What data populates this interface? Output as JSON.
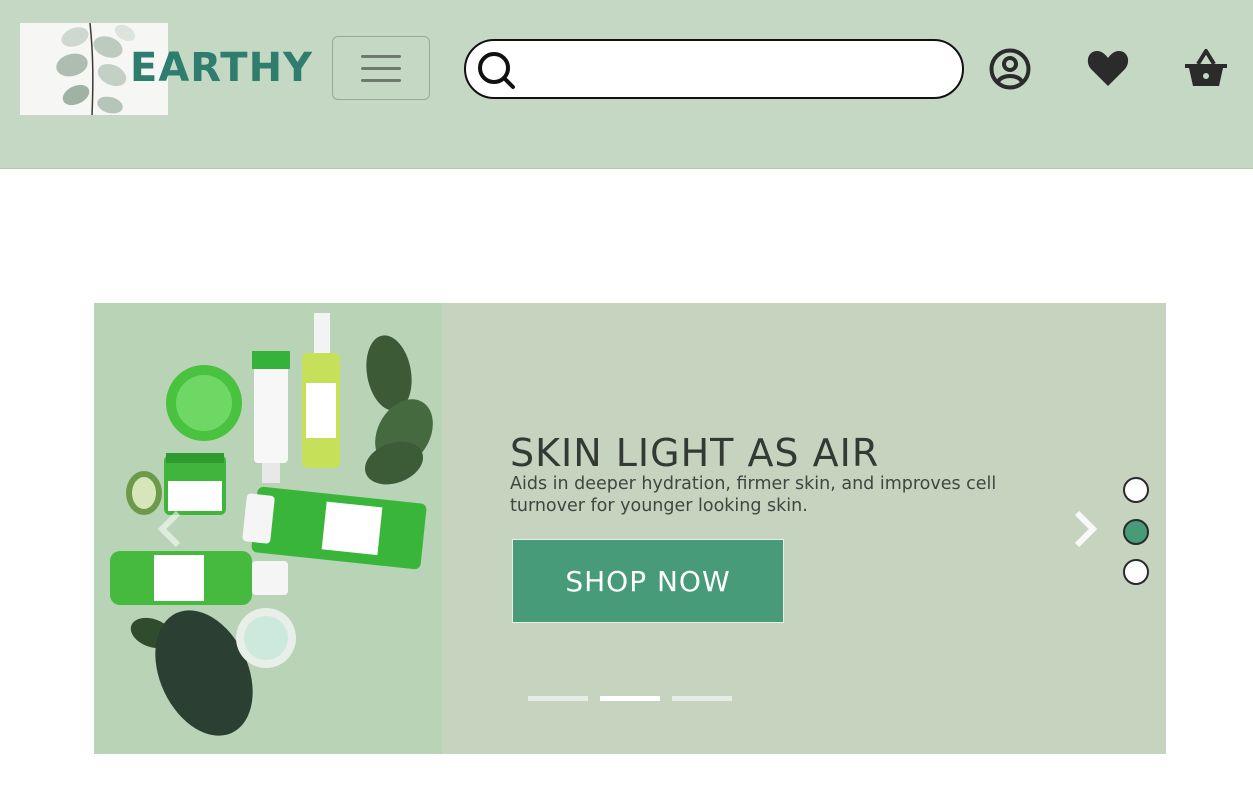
{
  "header": {
    "logo_text": "EARTHY",
    "search": {
      "value": "",
      "placeholder": ""
    }
  },
  "icons": {
    "menu": "hamburger-menu-icon",
    "search": "search-icon",
    "account": "user-circle-icon",
    "wishlist": "heart-icon",
    "cart": "basket-icon"
  },
  "hero": {
    "title": "SKIN LIGHT AS AIR",
    "description": "Aids in deeper hydration, firmer skin, and improves cell turnover for younger looking skin.",
    "button_label": "SHOP NOW",
    "dots": [
      {
        "active": false
      },
      {
        "active": true
      },
      {
        "active": false
      }
    ],
    "indicators": [
      {
        "active": false
      },
      {
        "active": true
      },
      {
        "active": false
      }
    ]
  },
  "colors": {
    "header_bg": "#c5d8c4",
    "brand_teal": "#2e7d6f",
    "accent_green": "#489b78",
    "hero_bg": "#c6d3bf"
  }
}
